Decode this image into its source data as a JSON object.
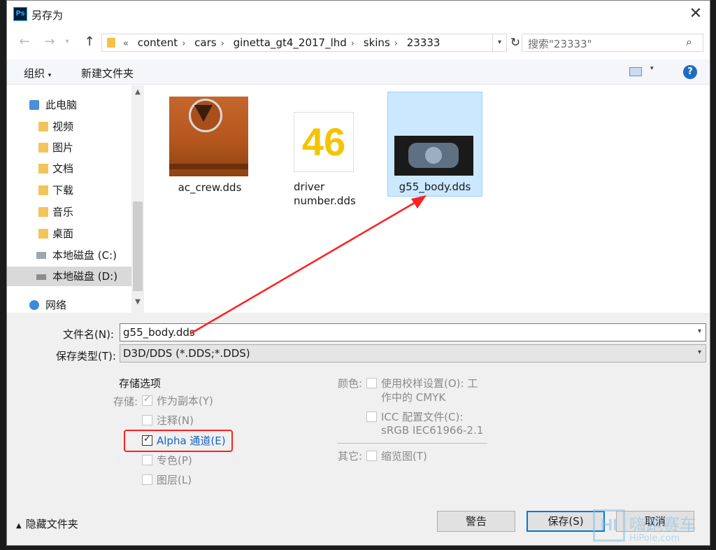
{
  "window": {
    "title": "另存为",
    "app_icon": "Ps"
  },
  "address": {
    "overflow": "«",
    "path": [
      "content",
      "cars",
      "ginetta_gt4_2017_lhd",
      "skins",
      "23333"
    ],
    "search_placeholder": "搜索\"23333\""
  },
  "toolbar": {
    "organize": "组织",
    "new_folder": "新建文件夹",
    "help": "?"
  },
  "nav": {
    "items": [
      {
        "label": "此电脑",
        "icon": "pc-icon"
      },
      {
        "label": "视频",
        "icon": "video-folder-icon"
      },
      {
        "label": "图片",
        "icon": "pictures-folder-icon"
      },
      {
        "label": "文档",
        "icon": "documents-folder-icon"
      },
      {
        "label": "下载",
        "icon": "downloads-folder-icon"
      },
      {
        "label": "音乐",
        "icon": "music-folder-icon"
      },
      {
        "label": "桌面",
        "icon": "desktop-folder-icon"
      },
      {
        "label": "本地磁盘 (C:)",
        "icon": "drive-c-icon"
      },
      {
        "label": "本地磁盘 (D:)",
        "icon": "drive-d-icon"
      },
      {
        "label": "网络",
        "icon": "network-icon"
      }
    ]
  },
  "files": [
    {
      "name": "ac_crew.dds",
      "number_text": ""
    },
    {
      "name": "driver number.dds",
      "line1": "driver",
      "line2": "number.dds",
      "number_text": "46"
    },
    {
      "name": "g55_body.dds"
    }
  ],
  "form": {
    "filename_label": "文件名(N):",
    "filename_value": "g55_body.dds",
    "filetype_label": "保存类型(T):",
    "filetype_value": "D3D/DDS (*.DDS;*.DDS)"
  },
  "options": {
    "title": "存储选项",
    "storage_label": "存储:",
    "as_copy": "作为副本(Y)",
    "notes": "注释(N)",
    "alpha": "Alpha 通道(E)",
    "spot": "专色(P)",
    "layers": "图层(L)",
    "color_label": "颜色:",
    "proof_line1": "使用校样设置(O):  工",
    "proof_line2": "作中的 CMYK",
    "icc_line1": "ICC 配置文件(C):",
    "icc_line2": "sRGB IEC61966-2.1",
    "other_label": "其它:",
    "thumbnail": "缩览图(T)"
  },
  "footer": {
    "hide_folders": "隐藏文件夹",
    "warning": "警告",
    "save": "保存(S)",
    "cancel": "取消"
  },
  "watermark": {
    "logo": "HI",
    "text": "嗨跑赛车",
    "sub": "HiPole.com"
  },
  "colors": {
    "accent": "#0078d7",
    "selection": "#cce8ff",
    "annotation_red": "#ff2020"
  }
}
